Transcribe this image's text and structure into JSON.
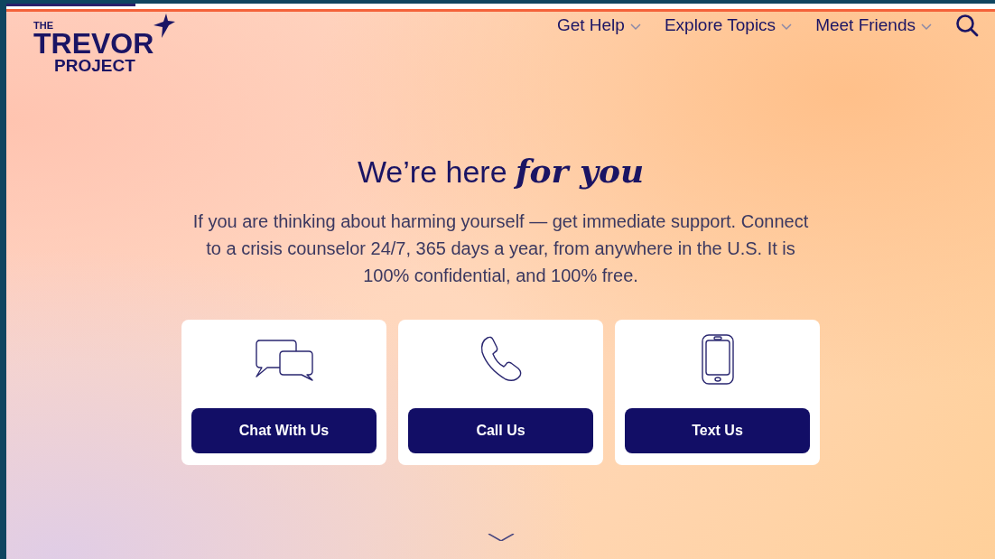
{
  "logo": {
    "lines": [
      "THE",
      "TREVOR",
      "PROJECT"
    ]
  },
  "nav": [
    {
      "label": "Get Help"
    },
    {
      "label": "Explore Topics"
    },
    {
      "label": "Meet Friends"
    }
  ],
  "heading": "We’re here *for you*",
  "intro": "If you are thinking about harming yourself — get immediate support. Connect to a crisis counselor 24/7, 365 days a year, from anywhere in the U.S. It is 100% confidential, and 100% free.",
  "cards": [
    {
      "kind": "chat",
      "button": "Chat With Us"
    },
    {
      "kind": "phone",
      "button": "Call Us"
    },
    {
      "kind": "mobile",
      "button": "Text Us"
    }
  ]
}
